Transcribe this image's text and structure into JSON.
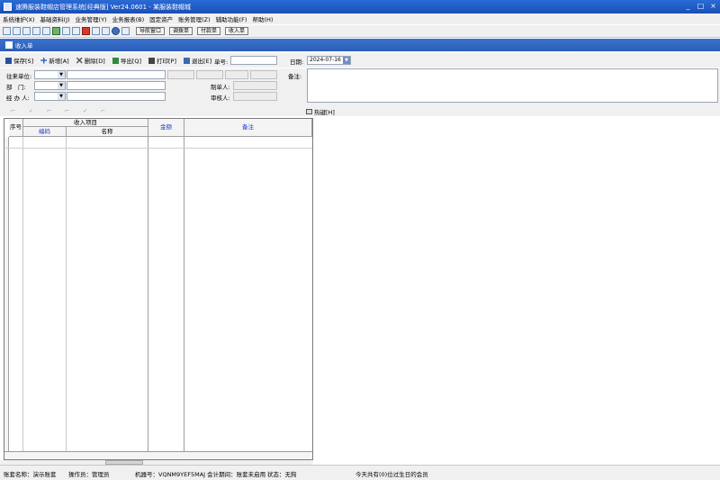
{
  "window": {
    "title": "速腾服装鞋帽店管理系统[经典版] Ver24.0601 - 某服装鞋帽城",
    "controls": [
      "_",
      "□",
      "×"
    ]
  },
  "menu": [
    "系统维护(X)",
    "基础资料(J)",
    "业务管理(Y)",
    "业务报表(B)",
    "固定资产",
    "账务管理(Z)",
    "辅助功能(F)",
    "帮助(H)"
  ],
  "toolbar": {
    "icons": [
      "new-doc-icon",
      "open-icon",
      "copy-icon",
      "calc-icon",
      "report-icon",
      "chart-icon",
      "user-icon",
      "tools-icon",
      "print-icon",
      "save-icon",
      "export-icon",
      "help-icon",
      "exit-icon"
    ],
    "buttons": [
      "导航窗口",
      "调拨单",
      "付款单",
      "收入单"
    ]
  },
  "tab": {
    "label": "收入单"
  },
  "actions": [
    {
      "label": "保存[S]",
      "icon": "save-icon",
      "color": "#2a4f9c"
    },
    {
      "label": "新增[A]",
      "icon": "add-icon",
      "color": "#2c62d8"
    },
    {
      "label": "删除[D]",
      "icon": "delete-icon",
      "color": "#555555"
    },
    {
      "label": "导出[Q]",
      "icon": "export-icon",
      "color": "#2e8b3e"
    },
    {
      "label": "打印[P]",
      "icon": "print-icon",
      "color": "#444444"
    },
    {
      "label": "退出[E]",
      "icon": "exit-icon",
      "color": "#3a6ab0"
    }
  ],
  "header": {
    "number_label": "单号:",
    "number_value": "",
    "date_label": "日期:",
    "date_value": "2024-07-16",
    "remark_label": "备注:"
  },
  "form": {
    "partner_label": "往来单位:",
    "dept_label": "部　门:",
    "handler_label": "经 办 人:",
    "maker_label": "制单人:",
    "auditor_label": "审核人:"
  },
  "subtoolbar": {
    "hotkey_label": "热键[H]"
  },
  "grid": {
    "headers": {
      "seq": "序号",
      "income_group": "收入项目",
      "code": "编码",
      "name": "名称",
      "amount": "金额",
      "remark": "备注"
    }
  },
  "status": {
    "account": "账套名称：演示账套",
    "operator": "操作员：管理员",
    "machine": "机器号：VQNM9YEF5MAJ 会计期间：账套未启用",
    "state": "状态：无狗",
    "birthday": "今天共有(0)位过生日的会员"
  }
}
